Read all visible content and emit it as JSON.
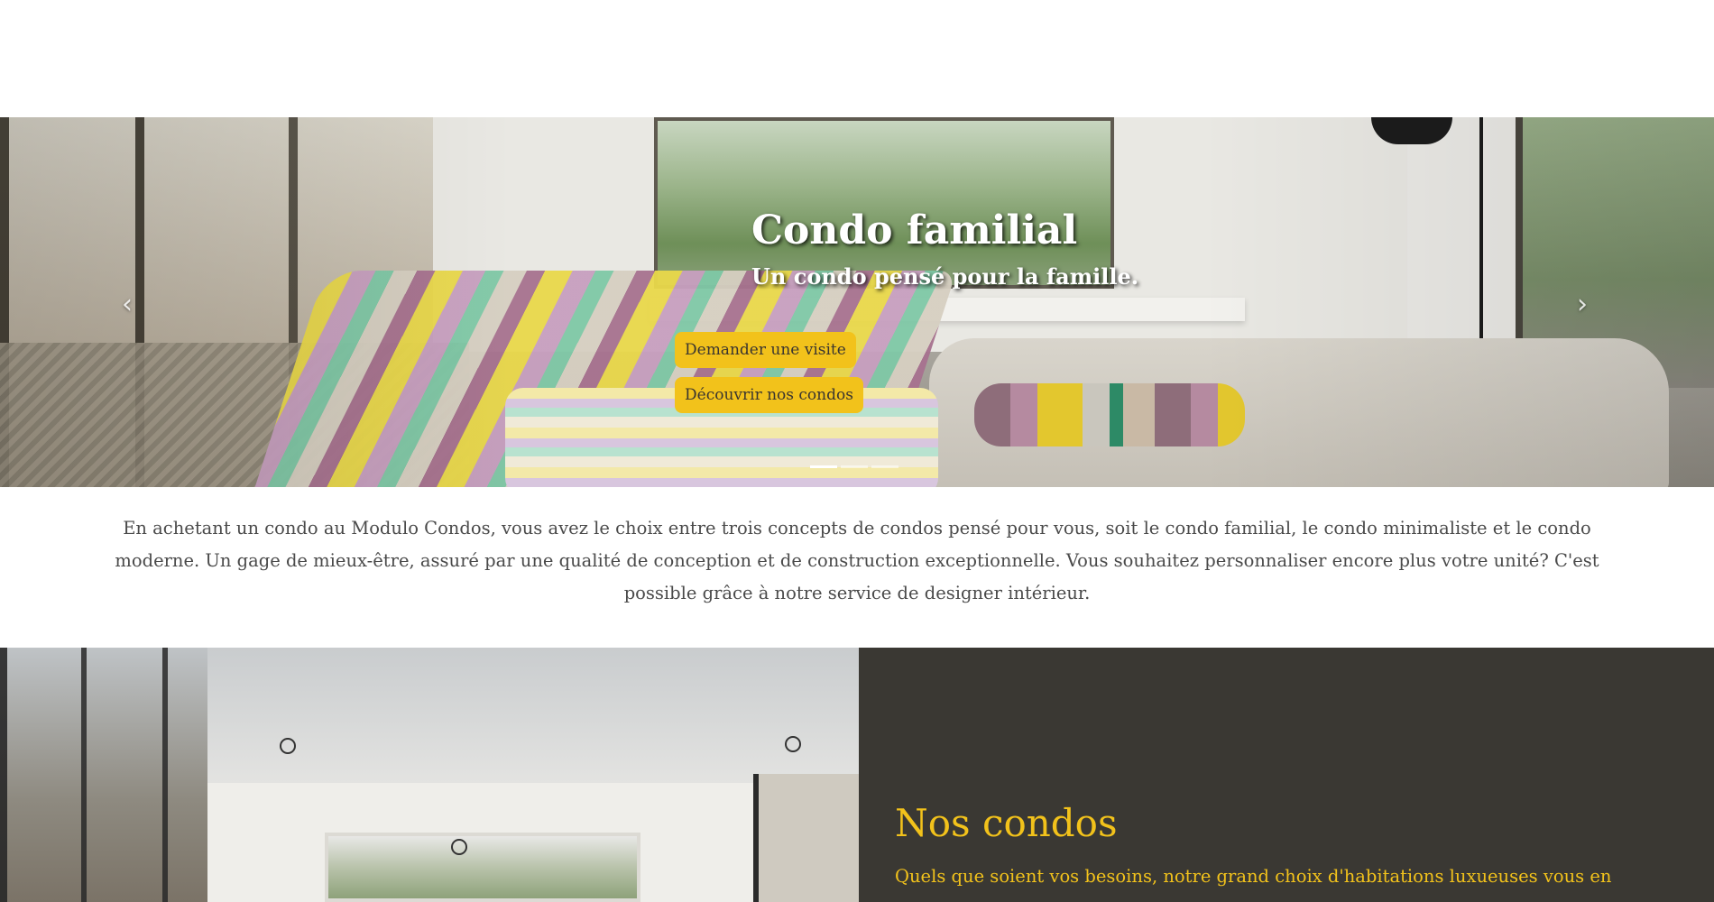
{
  "hero": {
    "title": "Condo familial",
    "subtitle": "Un condo pensé pour la famille.",
    "buttons": {
      "visit": "Demander une visite",
      "discover": "Découvrir nos condos"
    },
    "prev_icon": "chevron-left-icon",
    "next_icon": "chevron-right-icon",
    "prev_glyph": "‹",
    "next_glyph": "›",
    "slide_count": 3,
    "active_slide": 1
  },
  "intro": {
    "text": "En achetant un condo au Modulo Condos, vous avez le choix entre trois concepts de condos pensé pour vous, soit le condo familial, le condo minimaliste et le condo moderne. Un gage de mieux-être, assuré par une qualité de conception et de construction exceptionnelle. Vous souhaitez personnaliser encore plus votre unité? C'est possible grâce à notre service de designer intérieur."
  },
  "condos_section": {
    "title": "Nos condos",
    "text": "Quels que soient vos besoins, notre grand choix d'habitations luxueuses vous en"
  },
  "colors": {
    "accent": "#f2c21b",
    "panel_bg": "#3a3833",
    "text": "#4a4a4a"
  }
}
